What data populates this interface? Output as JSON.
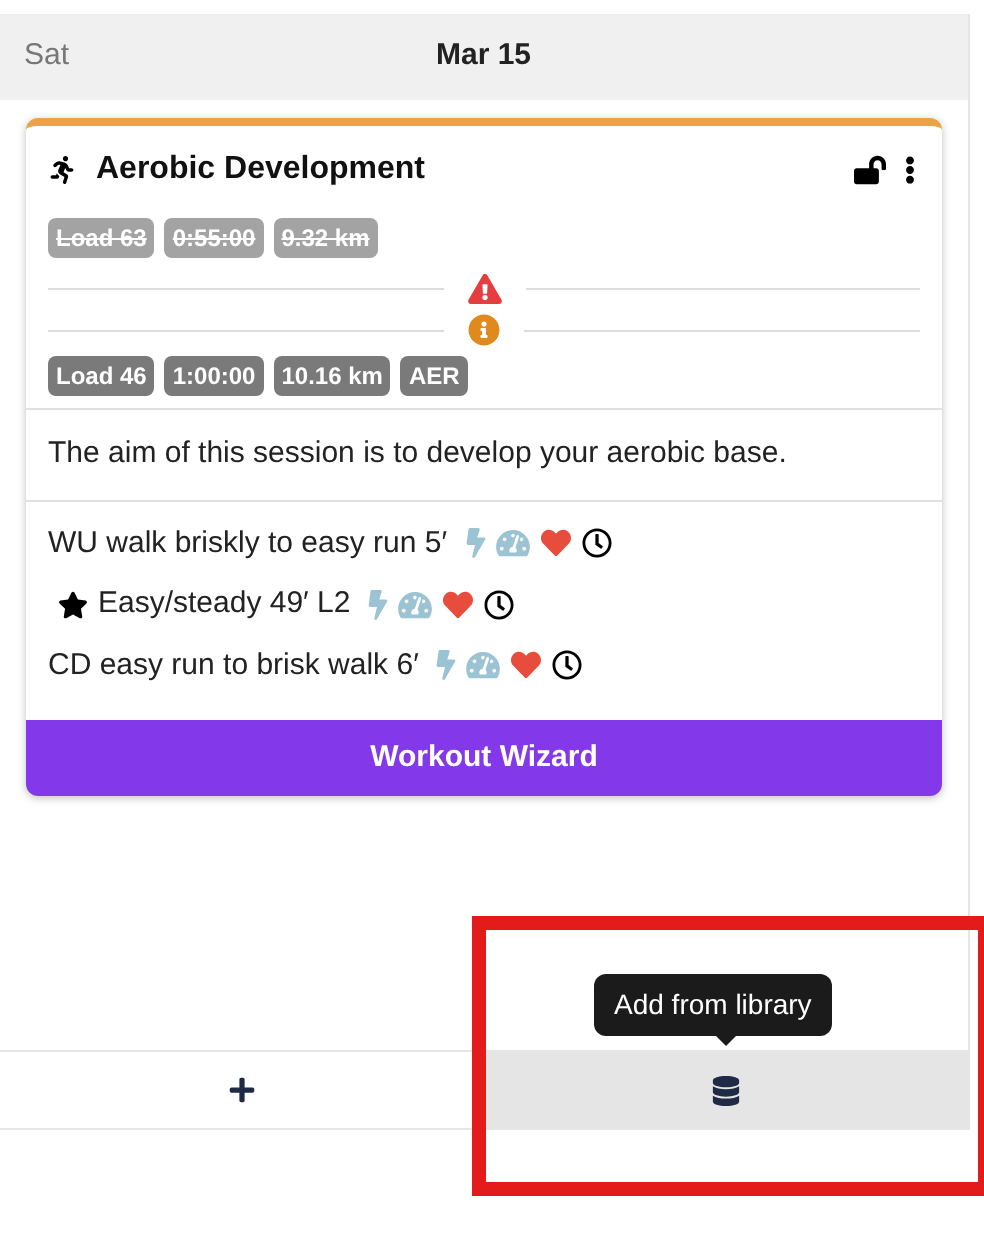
{
  "header": {
    "weekday": "Sat",
    "date": "Mar 15"
  },
  "workout": {
    "title": "Aerobic Development",
    "planned_badges": [
      {
        "text": "Load 63",
        "struck": true
      },
      {
        "text": "0:55:00",
        "struck": true
      },
      {
        "text": "9.32 km",
        "struck": true
      }
    ],
    "actual_badges": [
      {
        "text": "Load 46",
        "struck": false
      },
      {
        "text": "1:00:00",
        "struck": false
      },
      {
        "text": "10.16 km",
        "struck": false
      },
      {
        "text": "AER",
        "struck": false
      }
    ],
    "description": "The aim of this session is to develop your aerobic base.",
    "steps": [
      {
        "text": "WU walk briskly to easy run 5′",
        "starred": false
      },
      {
        "text": "Easy/steady 49′ L2",
        "starred": true
      },
      {
        "text": "CD easy run to brisk walk 6′",
        "starred": false
      }
    ],
    "button": "Workout Wizard"
  },
  "footer": {
    "tooltip": "Add from library",
    "buttons": [
      {
        "kind": "add",
        "hovered": false
      },
      {
        "kind": "library",
        "hovered": true
      }
    ]
  }
}
